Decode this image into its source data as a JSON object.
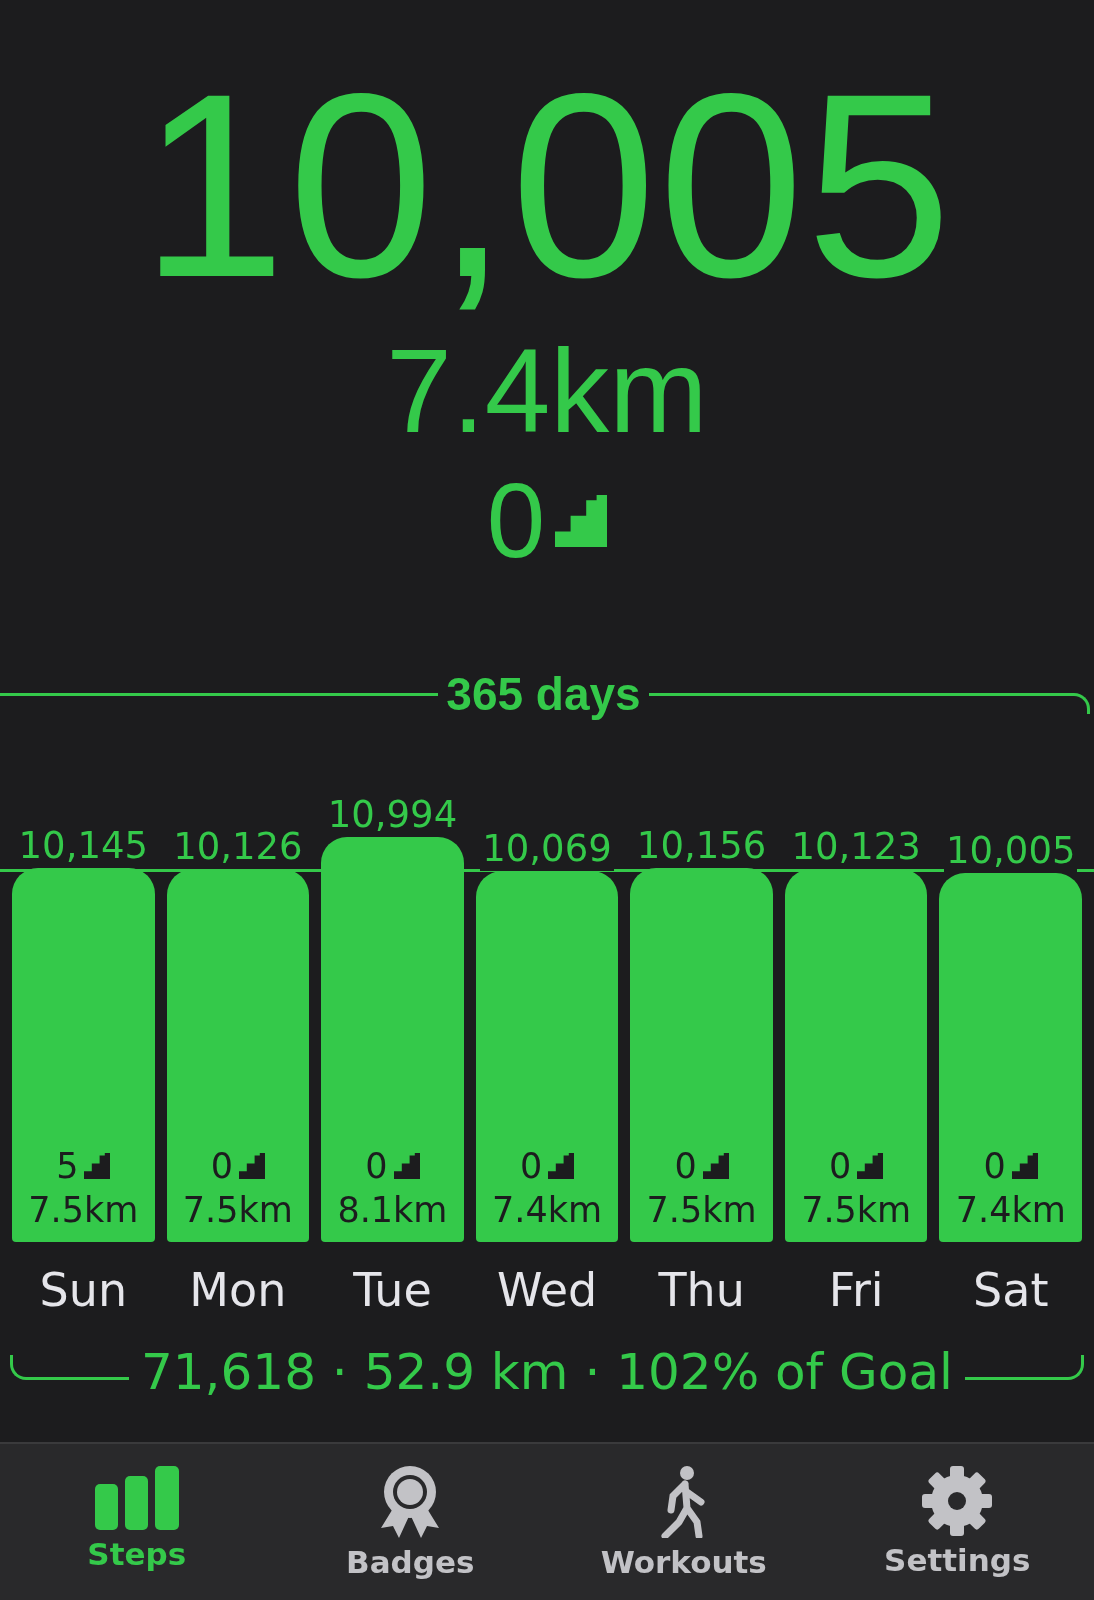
{
  "today": {
    "steps": "10,005",
    "distance": "7.4km",
    "floors": "0"
  },
  "period": {
    "label": "365 days"
  },
  "days": [
    {
      "day": "Sun",
      "steps": "10,145",
      "floors": "5",
      "distance": "7.5km"
    },
    {
      "day": "Mon",
      "steps": "10,126",
      "floors": "0",
      "distance": "7.5km"
    },
    {
      "day": "Tue",
      "steps": "10,994",
      "floors": "0",
      "distance": "8.1km"
    },
    {
      "day": "Wed",
      "steps": "10,069",
      "floors": "0",
      "distance": "7.4km"
    },
    {
      "day": "Thu",
      "steps": "10,156",
      "floors": "0",
      "distance": "7.5km"
    },
    {
      "day": "Fri",
      "steps": "10,123",
      "floors": "0",
      "distance": "7.5km"
    },
    {
      "day": "Sat",
      "steps": "10,005",
      "floors": "0",
      "distance": "7.4km"
    }
  ],
  "summary": "71,618 · 52.9 km · 102% of Goal",
  "tabs": [
    {
      "label": "Steps",
      "selected": true
    },
    {
      "label": "Badges",
      "selected": false
    },
    {
      "label": "Workouts",
      "selected": false
    },
    {
      "label": "Settings",
      "selected": false
    }
  ]
}
